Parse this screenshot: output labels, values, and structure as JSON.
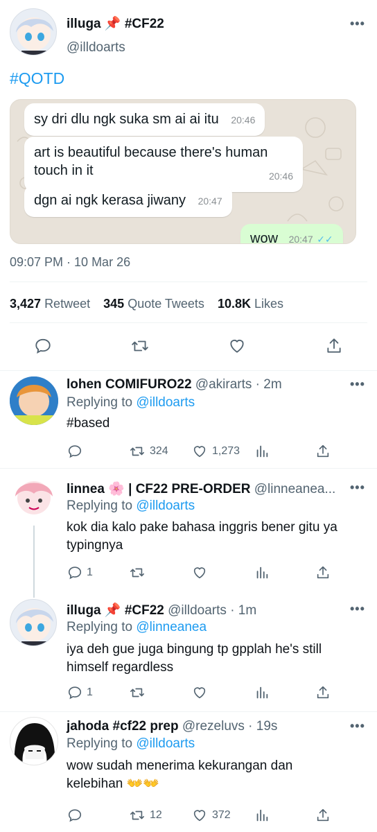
{
  "main_tweet": {
    "display_name": "illuga 📌 #CF22",
    "handle": "@illdoarts",
    "text": "#QOTD",
    "chat": [
      {
        "text": "sy dri dlu ngk suka sm ai ai itu",
        "time": "20:46",
        "side": "in"
      },
      {
        "text": "art is beautiful because there's human touch in it",
        "time": "20:46",
        "side": "in"
      },
      {
        "text": "dgn ai ngk kerasa jiwany",
        "time": "20:47",
        "side": "in"
      },
      {
        "text": "wow",
        "time": "20:47",
        "side": "out"
      }
    ],
    "timestamp": "09:07 PM · 10 Mar 26",
    "stats": {
      "retweets_count": "3,427",
      "retweets_label": "Retweet",
      "quotes_count": "345",
      "quotes_label": "Quote Tweets",
      "likes_count": "10.8K",
      "likes_label": "Likes"
    }
  },
  "replies": [
    {
      "display_name": "lohen COMIFURO22",
      "handle": "@akirarts",
      "time": "· 2m",
      "replying_label": "Replying to",
      "replying_to": "@illdoarts",
      "text": "#based",
      "retweets": "324",
      "likes": "1,273",
      "comments": ""
    },
    {
      "display_name": "linnea 🌸 | CF22 PRE-ORDER",
      "handle": "@linneanea...",
      "time": "",
      "replying_label": "Replying to",
      "replying_to": "@illdoarts",
      "text": "kok dia kalo pake bahasa inggris bener gitu ya typingnya",
      "comments": "1",
      "retweets": "",
      "likes": ""
    },
    {
      "display_name": "illuga 📌 #CF22",
      "handle": "@illdoarts",
      "time": "· 1m",
      "replying_label": "Replying to",
      "replying_to": "@linneanea",
      "text": "iya deh gue juga bingung tp gpplah he's still himself regardless",
      "comments": "1",
      "retweets": "",
      "likes": ""
    },
    {
      "display_name": "jahoda #cf22 prep",
      "handle": "@rezeluvs",
      "time": "· 19s",
      "replying_label": "Replying to",
      "replying_to": "@illdoarts",
      "text": "wow sudah menerima kekurangan dan kelebihan 👐👐",
      "comments": "",
      "retweets": "12",
      "likes": "372"
    }
  ],
  "colors": {
    "accent": "#1d9bf0",
    "secondary_text": "#536471",
    "chat_bg": "#e8e2d9",
    "outgoing_bubble": "#d9fdd3",
    "read_ticks": "#53bdeb"
  }
}
